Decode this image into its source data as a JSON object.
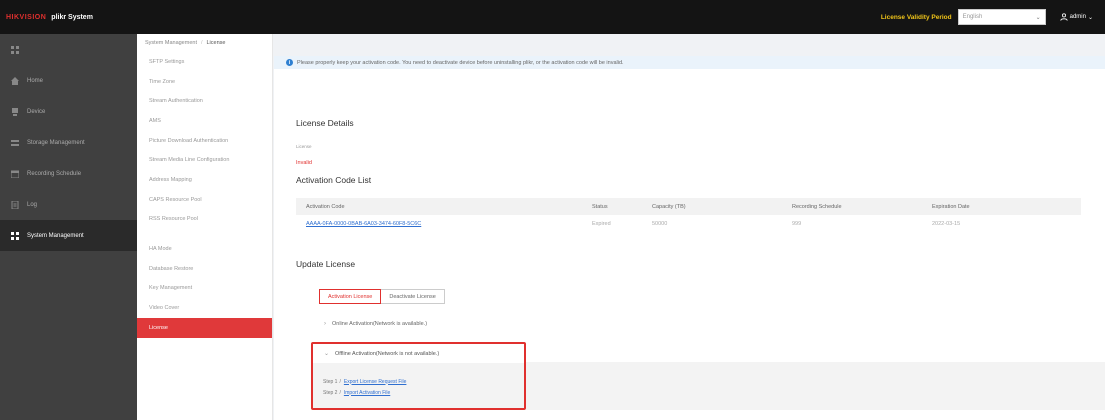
{
  "header": {
    "brand_red": "HIKVISION",
    "brand_grey": "",
    "product": "plikr System",
    "edition": "",
    "license_period": "License Validity Period",
    "language": "English",
    "user": "admin"
  },
  "sidebar": {
    "items": [
      {
        "label": "",
        "icon": "grid-icon"
      },
      {
        "label": "Home",
        "icon": "home-icon"
      },
      {
        "label": "Device",
        "icon": "device-icon"
      },
      {
        "label": "Storage Management",
        "icon": "storage-icon"
      },
      {
        "label": "Recording Schedule",
        "icon": "schedule-icon"
      },
      {
        "label": "Log",
        "icon": "log-icon"
      },
      {
        "label": "System Management",
        "icon": "settings-icon",
        "active": true
      }
    ]
  },
  "breadcrumb": {
    "parent": "System Management",
    "separator": "/",
    "current": "License"
  },
  "submenu": {
    "items": [
      {
        "label": "SFTP Settings"
      },
      {
        "label": "Time Zone"
      },
      {
        "label": "Stream Authentication"
      },
      {
        "label": "AMS"
      },
      {
        "label": "Picture Download Authentication"
      },
      {
        "label": "Stream Media Line Configuration"
      },
      {
        "label": "Address Mapping"
      },
      {
        "label": "CAPS Resource Pool"
      },
      {
        "label": "RSS Resource Pool"
      },
      {
        "label": "HA Mode",
        "gap": true
      },
      {
        "label": "Database Restore"
      },
      {
        "label": "Key Management"
      },
      {
        "label": "Video Cover"
      },
      {
        "label": "License",
        "active": true
      }
    ]
  },
  "notice": {
    "text": "Please properly keep your activation code. You need to deactivate device before uninstalling plikr, or the activation code will be invalid."
  },
  "license_details": {
    "title": "License Details",
    "label": "License",
    "value": "Invalid"
  },
  "activation_list": {
    "title": "Activation Code List",
    "columns": [
      "Activation Code",
      "Status",
      "Capacity (TB)",
      "Recording Schedule",
      "Expiration Date"
    ],
    "rows": [
      {
        "code": "AAAA-0FA-0000-0BAB-6A03-3474-60F8-5C6C",
        "status": "Expired",
        "capacity": "50000",
        "schedule": "999",
        "expiration": "2022-03-15"
      }
    ]
  },
  "update_license": {
    "title": "Update License",
    "tabs": [
      "Activation License",
      "Deactivate License"
    ],
    "online_label": "Online Activation(Network is available.)",
    "offline_label": "Offline Activation(Network is not available.)",
    "step1_prefix": "Step 1",
    "step1_link": "Export License Request File",
    "step2_prefix": "Step 2",
    "step2_link": "Import Activation File"
  },
  "colors": {
    "accent": "#e0302e",
    "license_period": "#f0c419",
    "link": "#2f6fd0",
    "info": "#2f80d1"
  }
}
